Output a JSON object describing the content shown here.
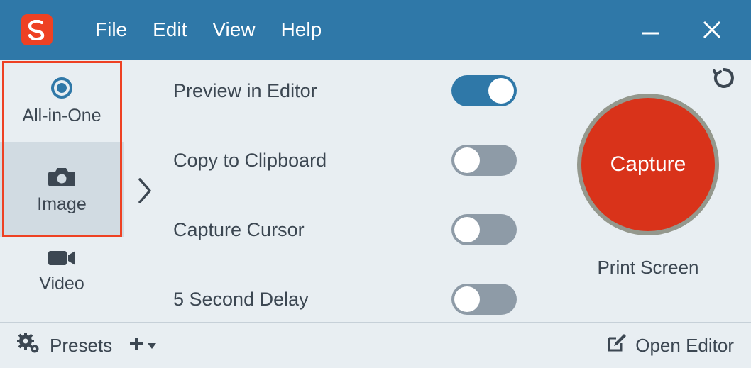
{
  "menu": {
    "file": "File",
    "edit": "Edit",
    "view": "View",
    "help": "Help"
  },
  "sidebar": {
    "allinone": {
      "label": "All-in-One"
    },
    "image": {
      "label": "Image",
      "selected": true
    },
    "video": {
      "label": "Video"
    }
  },
  "options": {
    "preview": {
      "label": "Preview in Editor",
      "on": true
    },
    "clipboard": {
      "label": "Copy to Clipboard",
      "on": false
    },
    "cursor": {
      "label": "Capture Cursor",
      "on": false
    },
    "delay": {
      "label": "5 Second Delay",
      "on": false
    }
  },
  "capture": {
    "button_label": "Capture",
    "shortcut": "Print Screen"
  },
  "footer": {
    "presets": "Presets",
    "open_editor": "Open Editor"
  },
  "colors": {
    "accent": "#d9331a",
    "header": "#2f78a8"
  }
}
